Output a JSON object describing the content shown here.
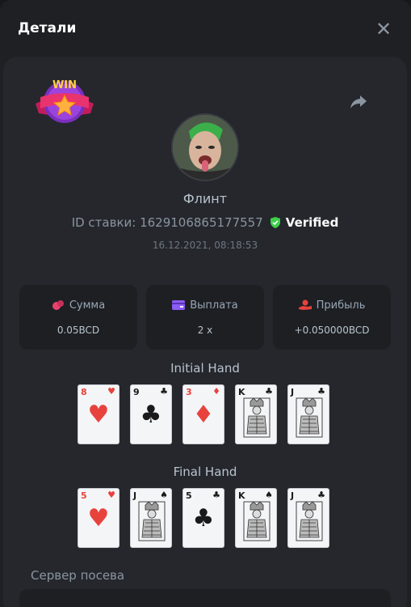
{
  "header": {
    "title": "Детали"
  },
  "player": {
    "name": "Флинт",
    "bet_id": "ID ставки: 1629106865177557",
    "verified": "Verified",
    "date": "16.12.2021, 08:18:53"
  },
  "badge": {
    "text": "WIN"
  },
  "stats": [
    {
      "label": "Сумма",
      "value": "0.05BCD",
      "icon": "coins-icon",
      "color": "#e8426c"
    },
    {
      "label": "Выплата",
      "value": "2 x",
      "icon": "wallet-icon",
      "color": "#8b5cf6"
    },
    {
      "label": "Прибыль",
      "value": "+0.050000BCD",
      "icon": "hand-coin-icon",
      "color": "#e8423c"
    }
  ],
  "initial_hand": {
    "title": "Initial Hand",
    "cards": [
      {
        "rank": "8",
        "suit": "♥",
        "color": "red"
      },
      {
        "rank": "9",
        "suit": "♣",
        "color": "black"
      },
      {
        "rank": "3",
        "suit": "♦",
        "color": "red"
      },
      {
        "rank": "K",
        "suit": "♣",
        "color": "black",
        "face": true
      },
      {
        "rank": "J",
        "suit": "♣",
        "color": "black",
        "face": true
      }
    ]
  },
  "final_hand": {
    "title": "Final Hand",
    "cards": [
      {
        "rank": "5",
        "suit": "♥",
        "color": "red"
      },
      {
        "rank": "J",
        "suit": "♠",
        "color": "black",
        "face": true
      },
      {
        "rank": "5",
        "suit": "♣",
        "color": "black"
      },
      {
        "rank": "K",
        "suit": "♠",
        "color": "black",
        "face": true
      },
      {
        "rank": "J",
        "suit": "♣",
        "color": "black",
        "face": true
      }
    ]
  },
  "seed": {
    "label": "Сервер посева"
  },
  "colors": {
    "accent_green": "#3ecf4a",
    "background": "#1e2024",
    "panel": "#25272c"
  }
}
